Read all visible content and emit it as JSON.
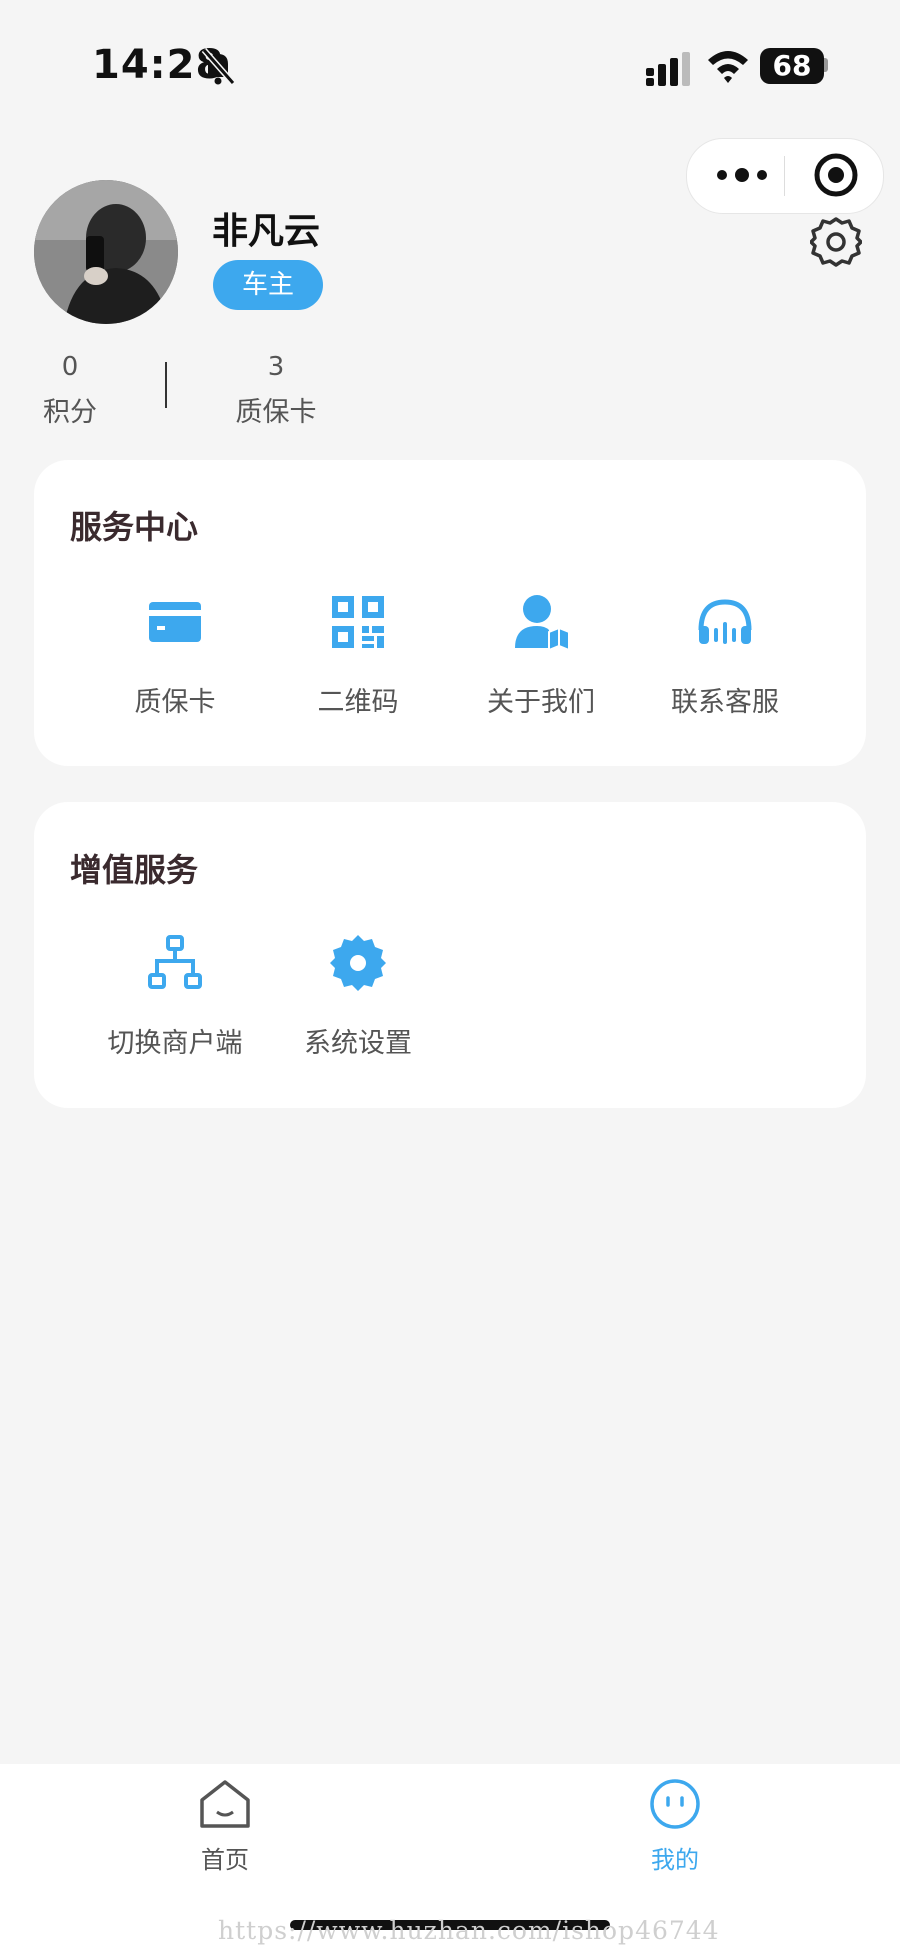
{
  "status_bar": {
    "time": "14:28",
    "battery": "68"
  },
  "colors": {
    "accent": "#3da8ee",
    "background": "#f5f5f5",
    "card": "#ffffff"
  },
  "profile": {
    "name": "非凡云",
    "role": "车主",
    "stats": [
      {
        "value": "0",
        "label": "积分"
      },
      {
        "value": "3",
        "label": "质保卡"
      }
    ]
  },
  "service_center": {
    "title": "服务中心",
    "items": [
      {
        "label": "质保卡",
        "icon": "credit-card-icon"
      },
      {
        "label": "二维码",
        "icon": "qr-code-icon"
      },
      {
        "label": "关于我们",
        "icon": "user-book-icon"
      },
      {
        "label": "联系客服",
        "icon": "headset-icon"
      }
    ]
  },
  "value_added": {
    "title": "增值服务",
    "items": [
      {
        "label": "切换商户端",
        "icon": "sitemap-icon"
      },
      {
        "label": "系统设置",
        "icon": "gear-icon"
      }
    ]
  },
  "tabbar": {
    "items": [
      {
        "label": "首页",
        "icon": "home-icon",
        "active": false
      },
      {
        "label": "我的",
        "icon": "smiley-icon",
        "active": true
      }
    ]
  },
  "watermark": "https://www.huzhan.com/ishop46744"
}
